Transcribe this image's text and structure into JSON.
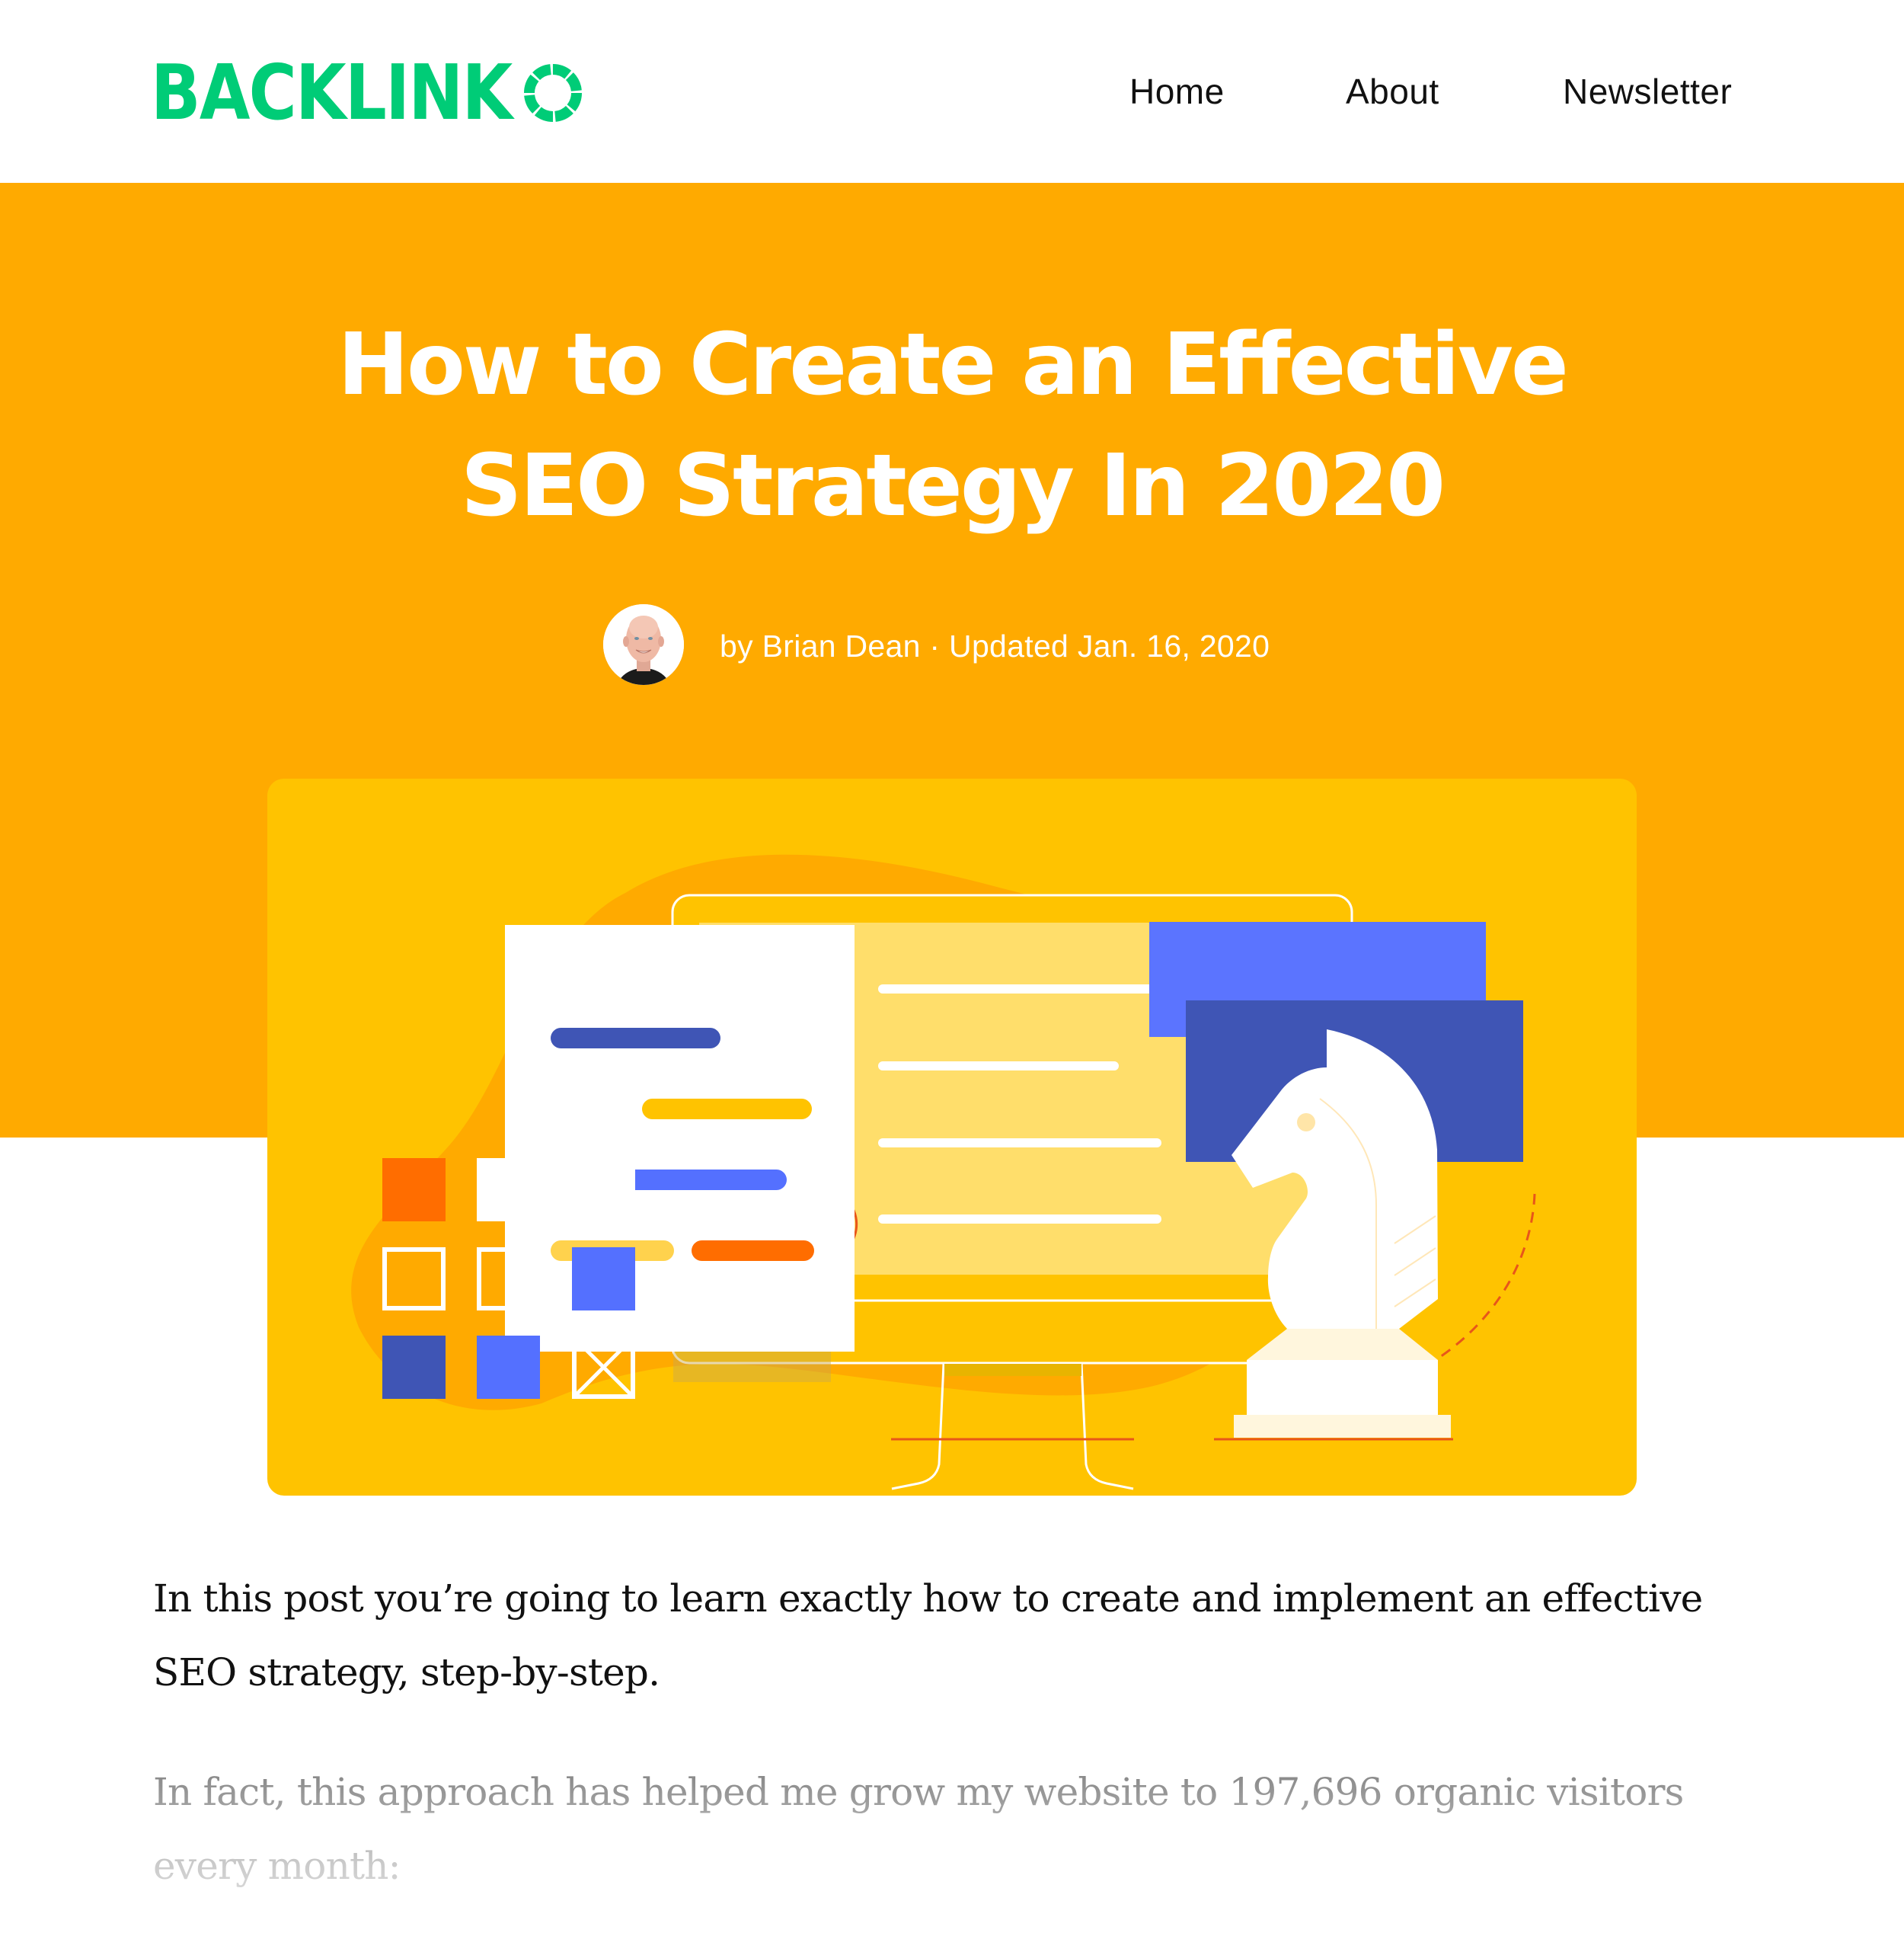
{
  "header": {
    "logo_text": "BACKLINK",
    "logo_ring_letter": "O",
    "brand_color": "#00CC77",
    "nav": [
      {
        "label": "Home"
      },
      {
        "label": "About"
      },
      {
        "label": "Newsletter"
      }
    ]
  },
  "hero": {
    "background_color": "#FFAA00",
    "title_lines": [
      "How to Create an Effective",
      "SEO Strategy In 2020"
    ],
    "byline": "by Brian Dean · Updated Jan. 16, 2020",
    "author": "Brian Dean",
    "updated": "Jan. 16, 2020",
    "avatar_icon": "author-avatar"
  },
  "illustration": {
    "card_color": "#FFC300",
    "icons": [
      "document-card-icon",
      "monitor-icon",
      "checklist-icon",
      "knight-chess-piece-icon",
      "color-grid-icon"
    ],
    "palette": {
      "dark_blue": "#3F55B5",
      "blue": "#5470FF",
      "orange": "#FF6D00",
      "light_yellow": "#FFDE6B",
      "cream": "#FFF6DD"
    }
  },
  "article": {
    "paragraphs": [
      "In this post you’re going to learn exactly how to create and implement an effective SEO strategy, step-by-step.",
      "In fact, this approach has helped me grow my website to 197,696 organic visitors every month:"
    ]
  }
}
